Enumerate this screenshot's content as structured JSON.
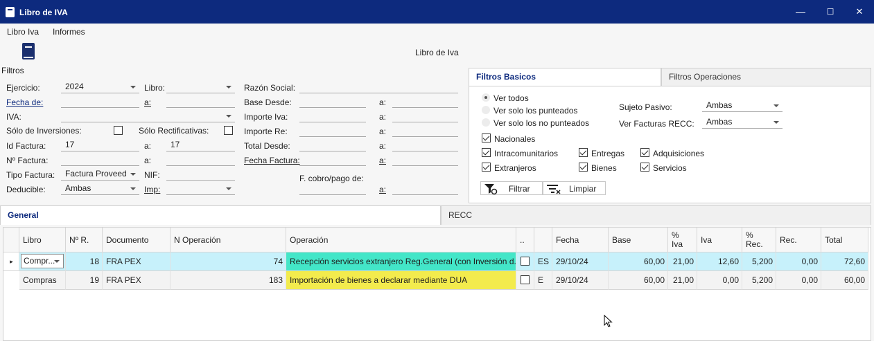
{
  "window": {
    "title": "Libro de IVA",
    "controls": {
      "minimize": "—",
      "maximize": "☐",
      "close": "✕"
    }
  },
  "menu": {
    "items": [
      "Libro Iva",
      "Informes"
    ]
  },
  "toolbar": {
    "filters_label": "Filtros",
    "center_title": "Libro de Iva"
  },
  "filters": {
    "ejercicio": {
      "label": "Ejercicio:",
      "value": "2024"
    },
    "libro": {
      "label": "Libro:",
      "value": ""
    },
    "razon_social": {
      "label": "Razón Social:",
      "value": ""
    },
    "fecha_de": {
      "label": "Fecha de:",
      "value": "",
      "a_label": "a:",
      "a_value": ""
    },
    "base_desde": {
      "label": "Base Desde:",
      "value": "",
      "a_label": "a:",
      "a_value": ""
    },
    "iva": {
      "label": "IVA:",
      "value": ""
    },
    "importe_iva": {
      "label": "Importe Iva:",
      "value": "",
      "a_label": "a:",
      "a_value": ""
    },
    "solo_inversiones": {
      "label": "Sólo de Inversiones:",
      "checked": false
    },
    "solo_rectificativas": {
      "label": "Sólo Rectificativas:",
      "checked": false
    },
    "importe_re": {
      "label": "Importe Re:",
      "value": "",
      "a_label": "a:",
      "a_value": ""
    },
    "id_factura": {
      "label": "Id Factura:",
      "value": "17",
      "a_label": "a:",
      "a_value": "17"
    },
    "total_desde": {
      "label": "Total Desde:",
      "value": "",
      "a_label": "a:",
      "a_value": ""
    },
    "n_factura": {
      "label": "Nº Factura:",
      "value": "",
      "a_label": "a:",
      "a_value": ""
    },
    "fecha_factura": {
      "label": "Fecha Factura:",
      "value": "",
      "a_label": "a:",
      "a_value": ""
    },
    "tipo_factura": {
      "label": "Tipo Factura:",
      "value": "Factura Proveed"
    },
    "nif": {
      "label": "NIF:",
      "value": ""
    },
    "f_cobro": {
      "label": "F. cobro/pago de:",
      "value": "",
      "a_label": "a:",
      "a_value": ""
    },
    "deducible": {
      "label": "Deducible:",
      "value": "Ambas"
    },
    "imp": {
      "label": "Imp:",
      "value": ""
    }
  },
  "filter_tabs": {
    "basic": "Filtros Basicos",
    "operations": "Filtros Operaciones"
  },
  "basic_filters": {
    "radios": [
      {
        "label": "Ver todos",
        "selected": true
      },
      {
        "label": "Ver solo los punteados",
        "selected": false
      },
      {
        "label": "Ver solo los no punteados",
        "selected": false
      }
    ],
    "sujeto_pasivo": {
      "label": "Sujeto Pasivo:",
      "value": "Ambas"
    },
    "ver_facturas_recc": {
      "label": "Ver Facturas RECC:",
      "value": "Ambas"
    },
    "checks": {
      "nacionales": {
        "label": "Nacionales",
        "checked": true
      },
      "intracomunitarios": {
        "label": "Intracomunitarios",
        "checked": true
      },
      "entregas": {
        "label": "Entregas",
        "checked": true
      },
      "adquisiciones": {
        "label": "Adquisiciones",
        "checked": true
      },
      "extranjeros": {
        "label": "Extranjeros",
        "checked": true
      },
      "bienes": {
        "label": "Bienes",
        "checked": true
      },
      "servicios": {
        "label": "Servicios",
        "checked": true
      }
    },
    "filter_button": "Filtrar",
    "clear_button": "Limpiar"
  },
  "grid_tabs": {
    "general": "General",
    "recc": "RECC"
  },
  "grid": {
    "headers": [
      "Libro",
      "Nº R.",
      "Documento",
      "N Operación",
      "Operación",
      "..",
      "",
      "Fecha",
      "Base",
      "%\nIva",
      "Iva",
      "%\nRec.",
      "Rec.",
      "Total"
    ],
    "rows": [
      {
        "libro": "Compr...",
        "nr": "18",
        "documento": "FRA PEX",
        "n_operacion": "74",
        "operacion": "Recepción servicios extranjero Reg.General (con Inversión d...",
        "checked": false,
        "pais": "ES",
        "fecha": "29/10/24",
        "base": "60,00",
        "pct_iva": "21,00",
        "iva": "12,60",
        "pct_rec": "5,200",
        "rec": "0,00",
        "total": "72,60",
        "op_color": "#43e6c8"
      },
      {
        "libro": "Compras",
        "nr": "19",
        "documento": "FRA PEX",
        "n_operacion": "183",
        "operacion": "Importación de bienes a declarar mediante DUA",
        "checked": false,
        "pais": "E",
        "fecha": "29/10/24",
        "base": "60,00",
        "pct_iva": "21,00",
        "iva": "0,00",
        "pct_rec": "5,200",
        "rec": "0,00",
        "total": "60,00",
        "op_color": "#f3eb4d"
      }
    ]
  },
  "colors": {
    "titlebar": "#0d2a7e",
    "selected_row": "#c7f1fb"
  }
}
